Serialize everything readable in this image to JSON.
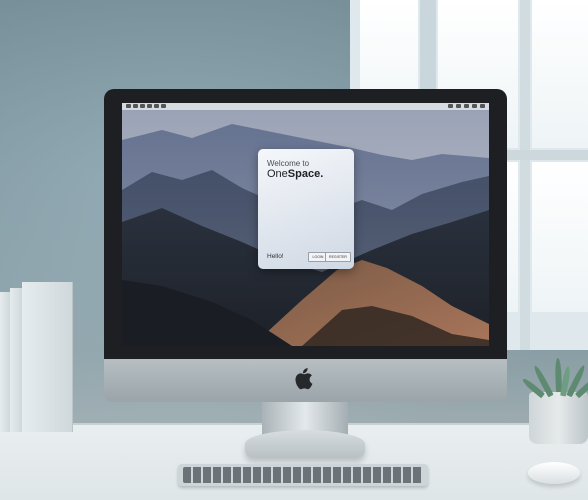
{
  "dialog": {
    "welcome_text": "Welcome to",
    "brand_prefix": "One",
    "brand_suffix": "Space.",
    "greeting": "Hello!",
    "login_label": "LOGIN",
    "register_label": "REGISTER"
  },
  "icons": {
    "apple": "apple-logo-icon"
  },
  "colors": {
    "bezel": "#1d1f22",
    "dialog_bg": "#eef2f7",
    "wallpaper_sky": "#8d97ac"
  }
}
